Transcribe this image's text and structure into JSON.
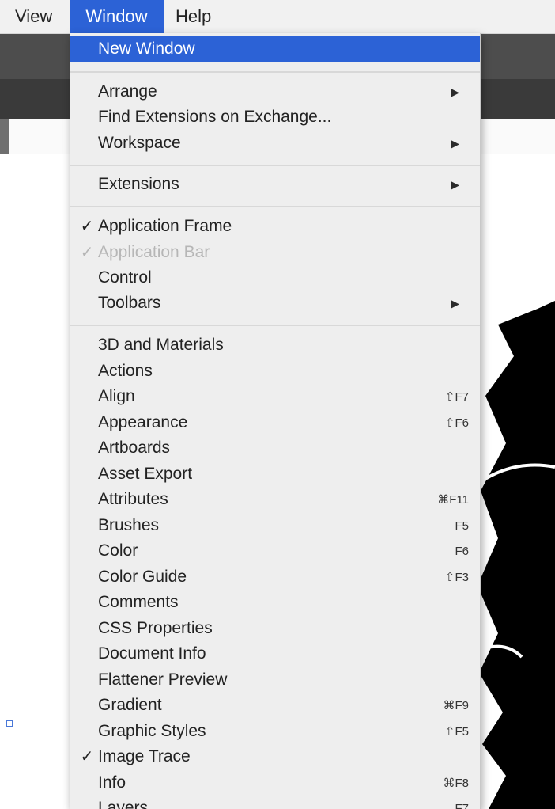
{
  "menubar": {
    "view": "View",
    "window": "Window",
    "help": "Help"
  },
  "menu": {
    "new_window": "New Window",
    "arrange": "Arrange",
    "find_extensions": "Find Extensions on Exchange...",
    "workspace": "Workspace",
    "extensions": "Extensions",
    "application_frame": "Application Frame",
    "application_bar": "Application Bar",
    "control": "Control",
    "toolbars": "Toolbars",
    "items": [
      {
        "label": "3D and Materials",
        "shortcut": ""
      },
      {
        "label": "Actions",
        "shortcut": ""
      },
      {
        "label": "Align",
        "shortcut": "⇧F7"
      },
      {
        "label": "Appearance",
        "shortcut": "⇧F6"
      },
      {
        "label": "Artboards",
        "shortcut": ""
      },
      {
        "label": "Asset Export",
        "shortcut": ""
      },
      {
        "label": "Attributes",
        "shortcut": "⌘F11"
      },
      {
        "label": "Brushes",
        "shortcut": "F5"
      },
      {
        "label": "Color",
        "shortcut": "F6"
      },
      {
        "label": "Color Guide",
        "shortcut": "⇧F3"
      },
      {
        "label": "Comments",
        "shortcut": ""
      },
      {
        "label": "CSS Properties",
        "shortcut": ""
      },
      {
        "label": "Document Info",
        "shortcut": ""
      },
      {
        "label": "Flattener Preview",
        "shortcut": ""
      },
      {
        "label": "Gradient",
        "shortcut": "⌘F9"
      },
      {
        "label": "Graphic Styles",
        "shortcut": "⇧F5"
      },
      {
        "label": "Image Trace",
        "shortcut": ""
      },
      {
        "label": "Info",
        "shortcut": "⌘F8"
      },
      {
        "label": "Layers",
        "shortcut": "F7"
      }
    ],
    "check": "✓",
    "arrow": "▶"
  }
}
